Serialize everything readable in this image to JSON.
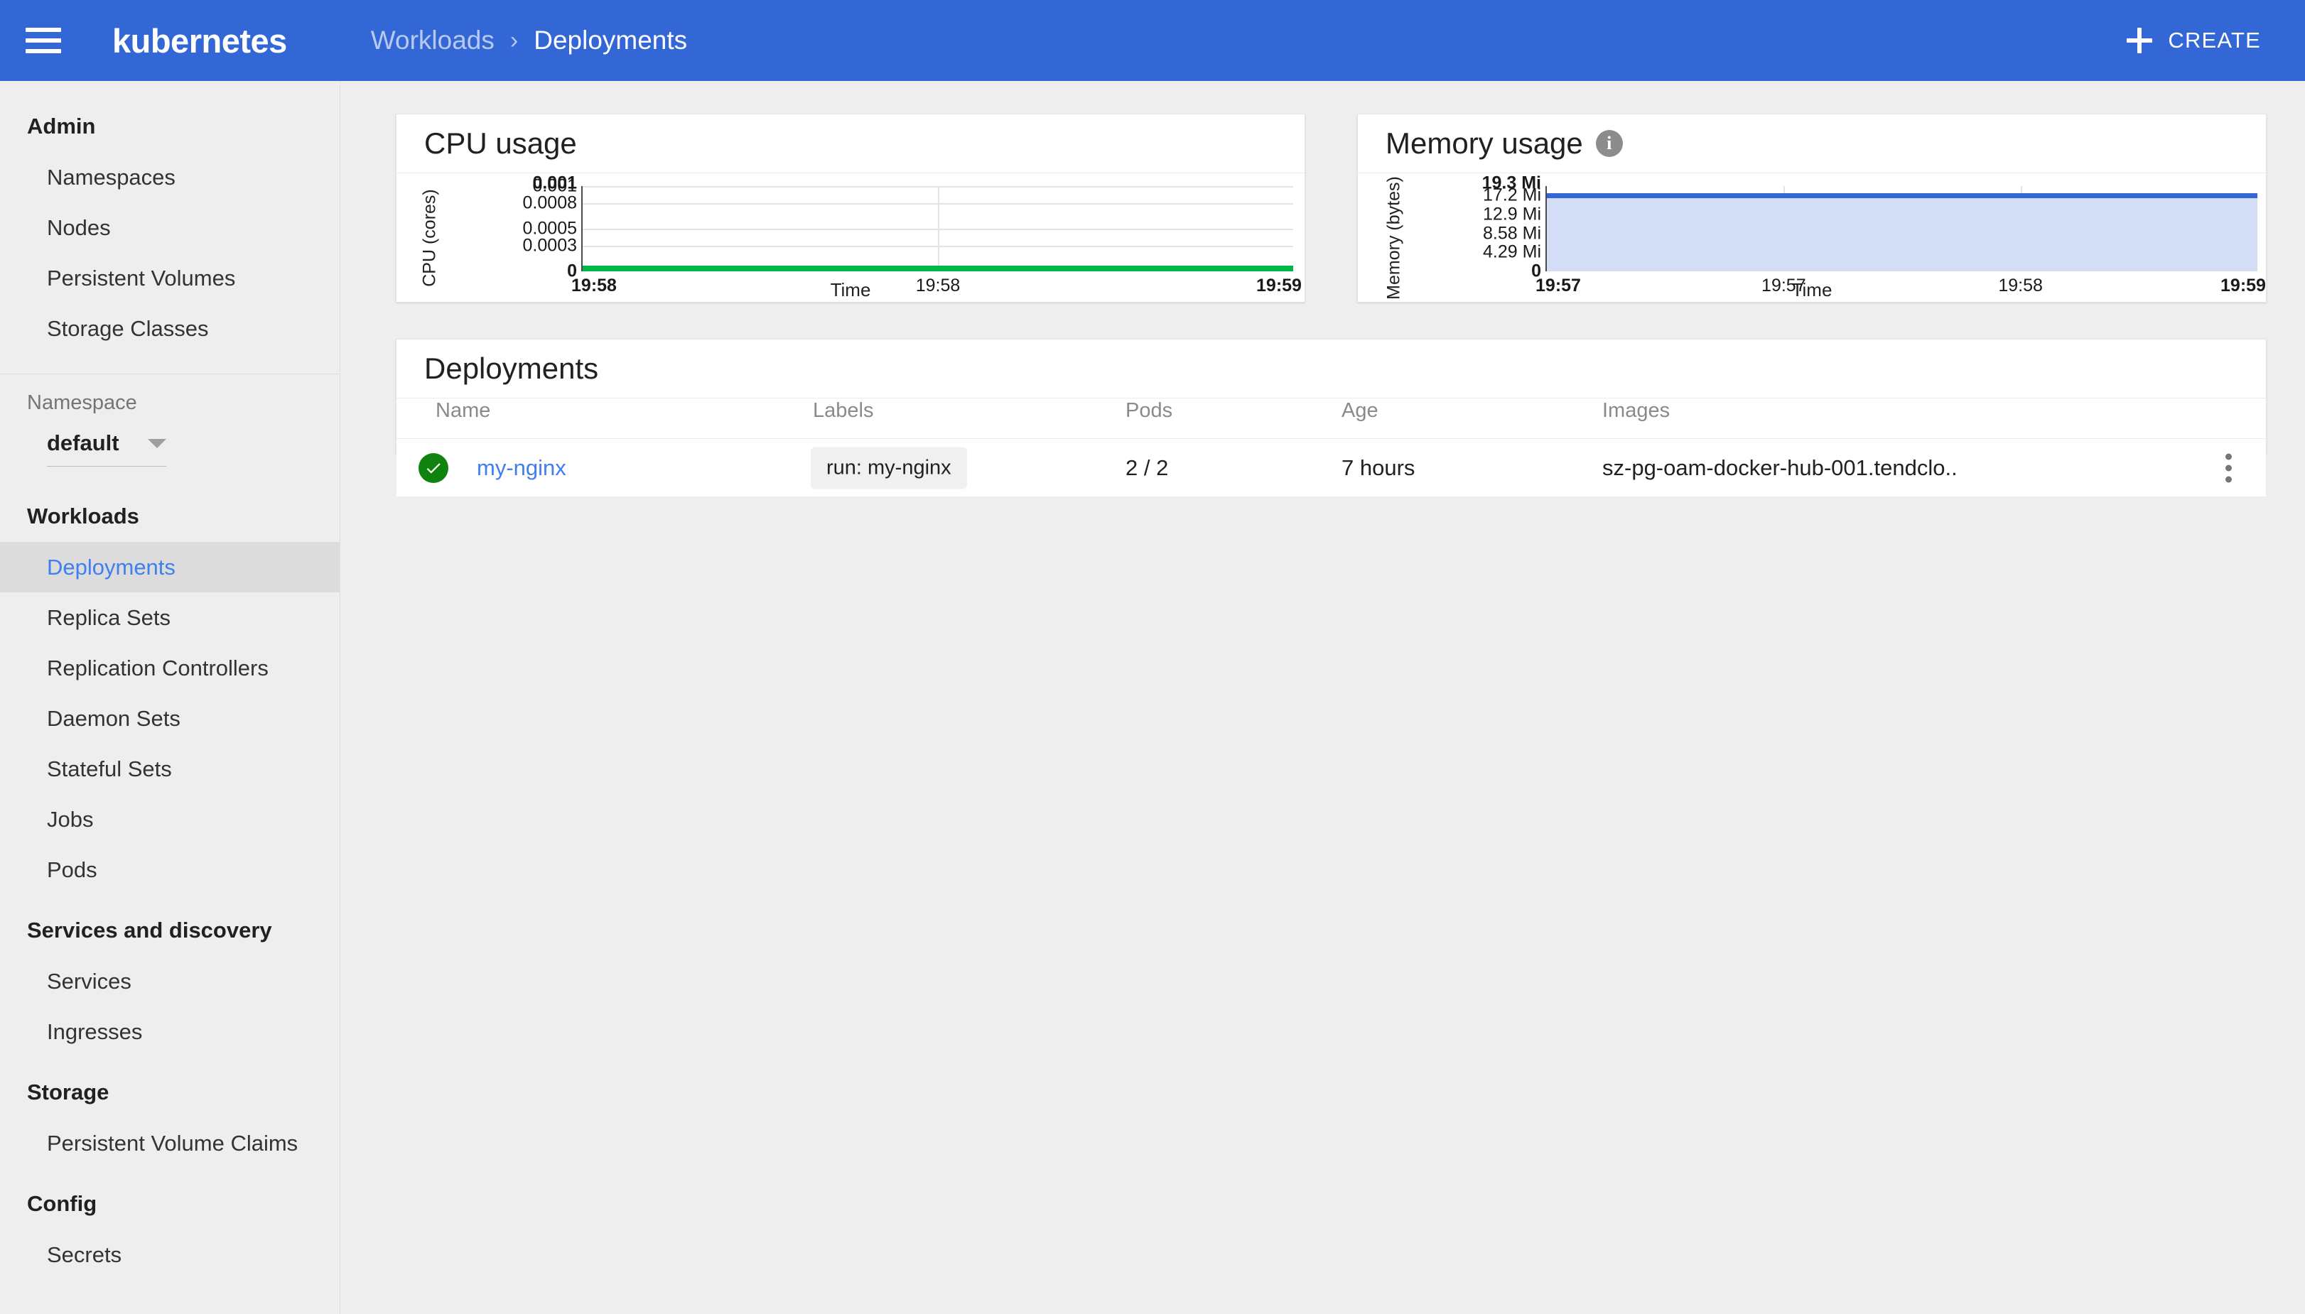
{
  "header": {
    "menu_icon": "hamburger-icon",
    "brand": "kubernetes",
    "breadcrumb": {
      "parent": "Workloads",
      "separator": "›",
      "current": "Deployments"
    },
    "create_button": {
      "label": "CREATE",
      "icon": "plus-icon"
    },
    "accent_color": "#3367d6"
  },
  "sidebar": {
    "sections": [
      {
        "title": "Admin",
        "items": [
          "Namespaces",
          "Nodes",
          "Persistent Volumes",
          "Storage Classes"
        ]
      },
      {
        "title": "Workloads",
        "items": [
          "Deployments",
          "Replica Sets",
          "Replication Controllers",
          "Daemon Sets",
          "Stateful Sets",
          "Jobs",
          "Pods"
        ]
      },
      {
        "title": "Services and discovery",
        "items": [
          "Services",
          "Ingresses"
        ]
      },
      {
        "title": "Storage",
        "items": [
          "Persistent Volume Claims"
        ]
      },
      {
        "title": "Config",
        "items": [
          "Secrets"
        ]
      }
    ],
    "active_item": "Deployments",
    "namespace": {
      "label": "Namespace",
      "value": "default",
      "caret_icon": "chevron-down-icon"
    }
  },
  "chart_data": [
    {
      "type": "line",
      "title": "CPU usage",
      "xlabel": "Time",
      "ylabel": "CPU (cores)",
      "ylim": [
        0,
        0.001
      ],
      "yticks": [
        "0.001",
        "0.001",
        "0.0008",
        "0.0005",
        "0.0003",
        "0"
      ],
      "ytick_values": [
        0.001,
        0.001,
        0.0008,
        0.0005,
        0.0003,
        0
      ],
      "ytick_bold": [
        true,
        false,
        false,
        false,
        false,
        true
      ],
      "xticks": [
        "19:58",
        "19:58",
        "19:59"
      ],
      "xtick_bold": [
        true,
        false,
        true
      ],
      "x": [
        "19:58",
        "19:58",
        "19:59"
      ],
      "values": [
        0,
        0,
        0
      ],
      "series_color": "#00b84a",
      "fill": false,
      "grid": true,
      "legend": "none"
    },
    {
      "type": "area",
      "title": "Memory usage",
      "info_icon": "info-icon",
      "xlabel": "Time",
      "ylabel": "Memory (bytes)",
      "ylim": [
        0,
        19.3
      ],
      "yticks": [
        "19.3 Mi",
        "17.2 Mi",
        "12.9 Mi",
        "8.58 Mi",
        "4.29 Mi",
        "0"
      ],
      "ytick_values": [
        19.3,
        17.2,
        12.9,
        8.58,
        4.29,
        0
      ],
      "ytick_bold": [
        true,
        false,
        false,
        false,
        false,
        true
      ],
      "xticks": [
        "19:57",
        "19:57",
        "19:58",
        "19:59"
      ],
      "xtick_bold": [
        true,
        false,
        false,
        true
      ],
      "x": [
        "19:57",
        "19:57",
        "19:58",
        "19:59"
      ],
      "values": [
        17.2,
        17.2,
        17.2,
        17.2
      ],
      "series_color": "#3367d6",
      "fill_color": "#d3ddf5",
      "grid": true,
      "legend": "none"
    }
  ],
  "deployments": {
    "title": "Deployments",
    "columns": [
      "Name",
      "Labels",
      "Pods",
      "Age",
      "Images"
    ],
    "rows": [
      {
        "status_icon": "success-check-icon",
        "name": "my-nginx",
        "label": "run: my-nginx",
        "pods": "2 / 2",
        "age": "7 hours",
        "images": "sz-pg-oam-docker-hub-001.tendclo..",
        "menu_icon": "overflow-menu-icon"
      }
    ]
  }
}
